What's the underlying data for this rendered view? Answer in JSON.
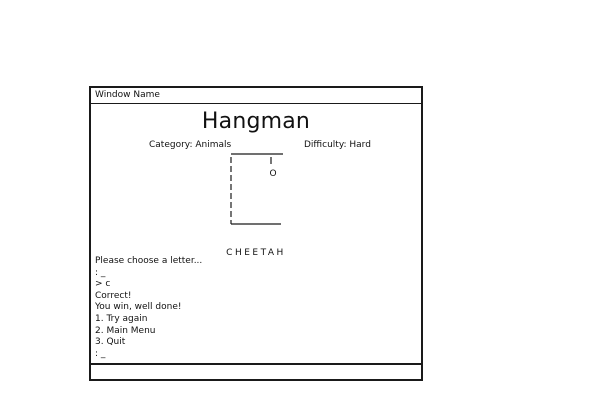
{
  "window": {
    "title": "Window Name"
  },
  "game": {
    "title": "Hangman",
    "category": "Category: Animals",
    "difficulty": "Difficulty: Hard",
    "head_glyph": "O",
    "word": "CHEETAH"
  },
  "console": {
    "lines": [
      "Please choose a letter...",
      ": _",
      "> c",
      "Correct!",
      "You win, well done!",
      "1. Try again",
      "2. Main Menu",
      "3. Quit",
      ": _"
    ]
  },
  "colors": {
    "stroke": "#1a1a1a",
    "background": "#ffffff"
  }
}
